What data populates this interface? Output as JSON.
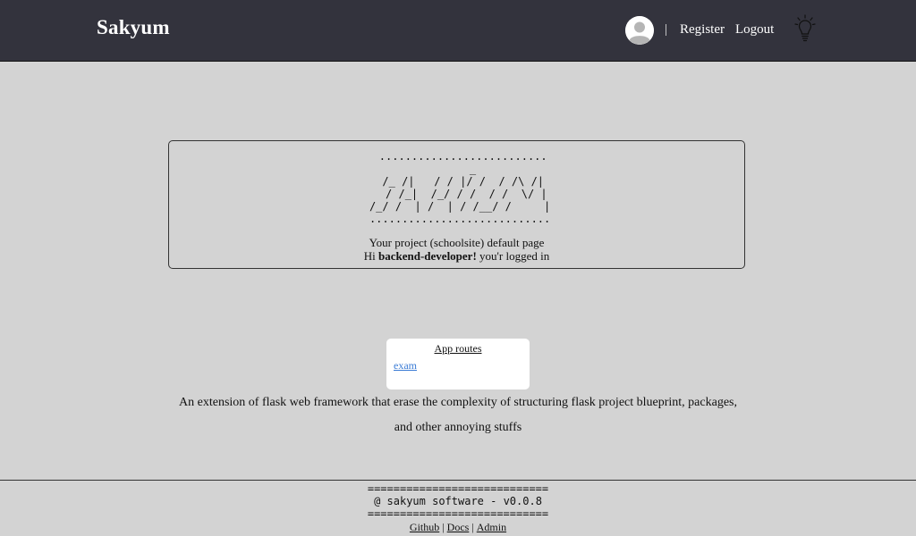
{
  "navbar": {
    "brand": "Sakyum",
    "separator": "|",
    "links": [
      "Register",
      "Logout"
    ],
    "icons": [
      "user-avatar-icon",
      "lightbulb-icon"
    ]
  },
  "banner": {
    "ascii_art": "  ..........................\n     _\n  /_ /|   / / |/ /  / /\\ /|\n   / /_|  /_/ / /  / /  \\/ |\n /_/ /  | /  | / /__/ /     |\n ............................",
    "line1": "Your project (schoolsite) default page",
    "greeting_prefix": "Hi ",
    "username": "backend-developer!",
    "greeting_suffix": " you'r logged in"
  },
  "routes": {
    "title": "App routes",
    "items": [
      "exam"
    ]
  },
  "description": "An extension of flask web framework that erase the complexity of structuring flask project blueprint, packages, and other annoying stuffs",
  "footer": {
    "ascii_text": "============================\n@ sakyum software - v0.0.8\n============================",
    "links": [
      "Github",
      "Docs",
      "Admin"
    ],
    "separator": "|"
  },
  "colors": {
    "navbar_bg": "#33333d",
    "page_bg": "#d3d3d3",
    "link": "#3a7bd5"
  }
}
